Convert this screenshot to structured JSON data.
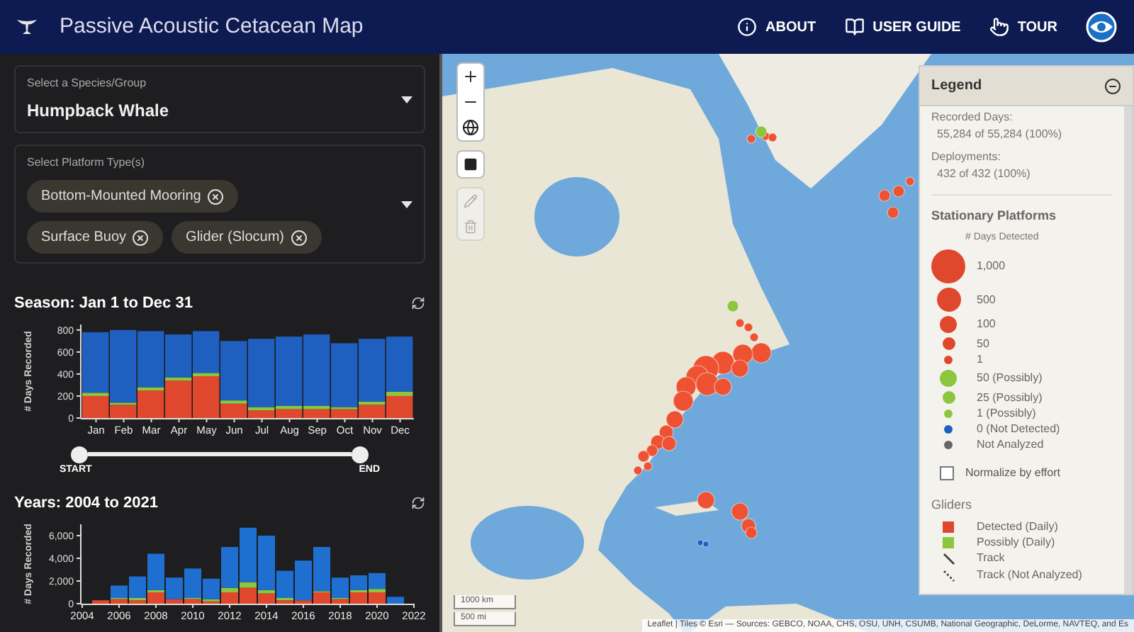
{
  "header": {
    "title": "Passive Acoustic Cetacean Map",
    "nav": [
      {
        "kind": "info",
        "label": "ABOUT"
      },
      {
        "kind": "book",
        "label": "USER GUIDE"
      },
      {
        "kind": "hand",
        "label": "TOUR"
      }
    ]
  },
  "species_select": {
    "label": "Select a Species/Group",
    "value": "Humpback Whale"
  },
  "platform_select": {
    "label": "Select Platform Type(s)",
    "chips": [
      "Bottom-Mounted Mooring",
      "Surface Buoy",
      "Glider (Slocum)"
    ]
  },
  "season": {
    "title": "Season: Jan 1 to Dec 31",
    "slider": {
      "start_label": "START",
      "end_label": "END"
    },
    "chart_data": {
      "type": "bar",
      "stacked": true,
      "ylabel": "# Days Recorded",
      "categories": [
        "Jan",
        "Feb",
        "Mar",
        "Apr",
        "May",
        "Jun",
        "Jul",
        "Aug",
        "Sep",
        "Oct",
        "Nov",
        "Dec"
      ],
      "ylim": [
        0,
        850
      ],
      "yticks": [
        0,
        200,
        400,
        600,
        800
      ],
      "series": [
        {
          "color": "#e0482e",
          "values": [
            200,
            120,
            250,
            340,
            380,
            130,
            70,
            80,
            80,
            80,
            120,
            200
          ]
        },
        {
          "color": "#8cc63f",
          "values": [
            30,
            20,
            30,
            30,
            30,
            30,
            30,
            30,
            30,
            20,
            30,
            40
          ]
        },
        {
          "color": "#1f5fbf",
          "values": [
            550,
            660,
            510,
            390,
            380,
            540,
            620,
            630,
            650,
            580,
            570,
            500
          ]
        }
      ]
    }
  },
  "years": {
    "title": "Years: 2004 to 2021",
    "chart_data": {
      "type": "bar",
      "stacked": true,
      "ylabel": "# Days Recorded",
      "x": [
        2005,
        2006,
        2007,
        2008,
        2009,
        2010,
        2011,
        2012,
        2013,
        2014,
        2015,
        2016,
        2017,
        2018,
        2019,
        2020,
        2021
      ],
      "xlim": [
        2004,
        2022
      ],
      "xticks": [
        2004,
        2006,
        2008,
        2010,
        2012,
        2014,
        2016,
        2018,
        2020,
        2022
      ],
      "ylim": [
        0,
        7000
      ],
      "yticks": [
        {
          "value": 0,
          "label": "0"
        },
        {
          "value": 2000,
          "label": "2,000"
        },
        {
          "value": 4000,
          "label": "4,000"
        },
        {
          "value": 6000,
          "label": "6,000"
        }
      ],
      "series": [
        {
          "color": "#e0482e",
          "values": [
            300,
            400,
            300,
            1000,
            400,
            400,
            200,
            1000,
            1400,
            900,
            300,
            300,
            1000,
            400,
            1000,
            1000,
            0
          ]
        },
        {
          "color": "#8cc63f",
          "values": [
            0,
            100,
            200,
            200,
            0,
            100,
            200,
            400,
            500,
            300,
            200,
            0,
            100,
            100,
            200,
            300,
            0
          ]
        },
        {
          "color": "#1f6fd0",
          "values": [
            0,
            1100,
            1900,
            3200,
            1900,
            2600,
            1800,
            3600,
            4800,
            4800,
            2400,
            3500,
            3900,
            1800,
            1300,
            1400,
            600
          ]
        }
      ]
    }
  },
  "map": {
    "scale": [
      "1000 km",
      "500 mi"
    ],
    "attribution": "Leaflet | Tiles © Esri — Sources: GEBCO, NOAA, CHS, OSU, UNH, CSUMB, National Geographic, DeLorme, NAVTEQ, and Es"
  },
  "legend": {
    "title": "Legend",
    "stats": [
      {
        "label": "Recorded Days:",
        "value": "55,284 of 55,284 (100%)"
      },
      {
        "label": "Deployments:",
        "value": "432 of 432 (100%)"
      }
    ],
    "stationary": {
      "title": "Stationary Platforms",
      "subtitle": "# Days Detected",
      "items": [
        {
          "kind": "bubble",
          "label": "1,000",
          "color": "#e0482e"
        },
        {
          "kind": "bubble",
          "label": "500",
          "color": "#e0482e"
        },
        {
          "kind": "bubble",
          "label": "100",
          "color": "#e0482e"
        },
        {
          "kind": "bubble",
          "label": "50",
          "color": "#e0482e"
        },
        {
          "kind": "bubble",
          "label": "1",
          "color": "#e0482e"
        },
        {
          "kind": "bubble",
          "label": "50 (Possibly)",
          "color": "#8cc63f"
        },
        {
          "kind": "bubble",
          "label": "25 (Possibly)",
          "color": "#8cc63f"
        },
        {
          "kind": "bubble",
          "label": "1 (Possibly)",
          "color": "#8cc63f"
        },
        {
          "kind": "dot",
          "label": "0 (Not Detected)",
          "color": "#1f5fbf"
        },
        {
          "kind": "dot",
          "label": "Not Analyzed",
          "color": "#666666"
        }
      ]
    },
    "normalize": {
      "label": "Normalize by effort",
      "checked": false
    },
    "gliders": {
      "title": "Gliders",
      "items": [
        {
          "kind": "square",
          "label": "Detected (Daily)",
          "color": "#e0482e"
        },
        {
          "kind": "square",
          "label": "Possibly (Daily)",
          "color": "#8cc63f"
        },
        {
          "kind": "track",
          "label": "Track"
        },
        {
          "kind": "dashed-track",
          "label": "Track (Not Analyzed)"
        }
      ]
    }
  }
}
